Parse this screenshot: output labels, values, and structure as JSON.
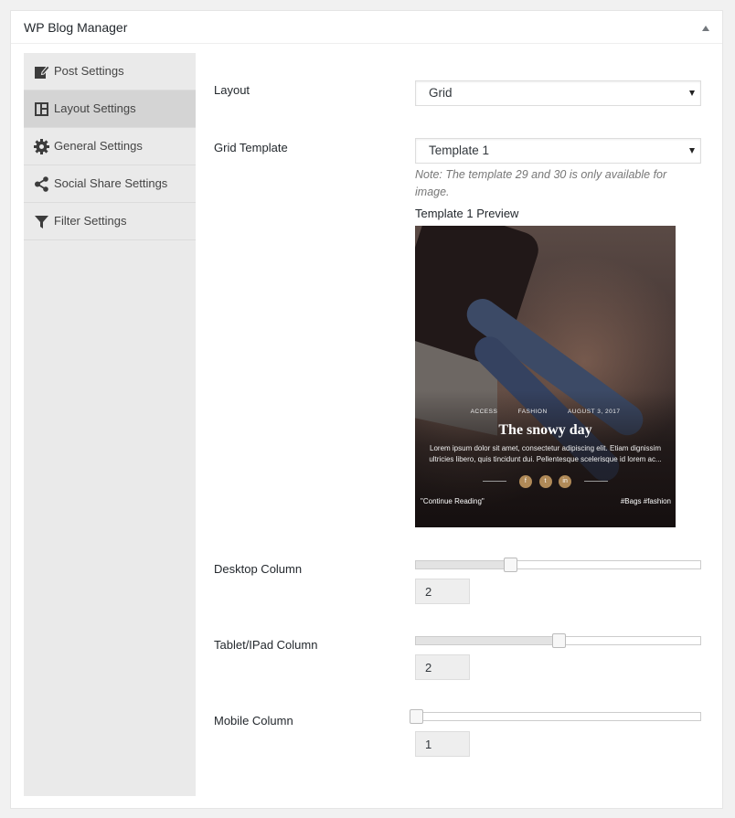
{
  "panel": {
    "title": "WP Blog Manager"
  },
  "sidebar": {
    "items": [
      {
        "label": "Post Settings",
        "icon": "edit-icon",
        "active": false
      },
      {
        "label": "Layout Settings",
        "icon": "layout-icon",
        "active": true
      },
      {
        "label": "General Settings",
        "icon": "gear-icon",
        "active": false
      },
      {
        "label": "Social Share Settings",
        "icon": "share-icon",
        "active": false
      },
      {
        "label": "Filter Settings",
        "icon": "filter-icon",
        "active": false
      }
    ]
  },
  "layout": {
    "label": "Layout",
    "value": "Grid"
  },
  "grid_template": {
    "label": "Grid Template",
    "value": "Template 1",
    "note": "Note: The template 29 and 30 is only available for image."
  },
  "preview": {
    "title": "Template 1 Preview",
    "categories": [
      "ACCESS",
      "FASHION",
      "AUGUST 3, 2017"
    ],
    "post_title": "The snowy day",
    "excerpt": "Lorem ipsum dolor sit amet, consectetur adipiscing elit. Etiam dignissim\nultricies libero, quis tincidunt dui. Pellentesque scelerisque id lorem ac...",
    "social": [
      "f",
      "t",
      "in"
    ],
    "read_more": "\"Continue Reading\"",
    "tags": "#Bags  #fashion"
  },
  "columns": {
    "desktop": {
      "label": "Desktop Column",
      "value": "2",
      "level": 0.33
    },
    "tablet": {
      "label": "Tablet/IPad Column",
      "value": "2",
      "level": 0.5
    },
    "mobile": {
      "label": "Mobile Column",
      "value": "1",
      "level": 0.0
    }
  }
}
